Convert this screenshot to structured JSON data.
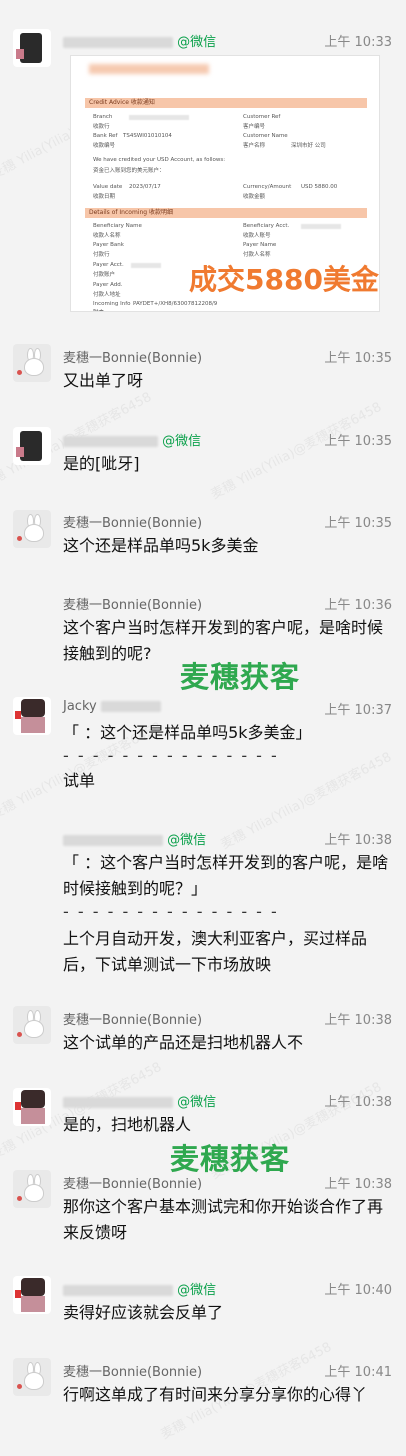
{
  "watermark": "麦穗 Yilia(Yilia)@麦穗获客6458",
  "messages": [
    {
      "sender": "@微信",
      "time": "上午 10:33"
    },
    {
      "sender": "麦穗一Bonnie(Bonnie)",
      "time": "上午 10:35",
      "text": "又出单了呀"
    },
    {
      "sender": "@微信",
      "time": "上午 10:35",
      "text": "是的[呲牙]"
    },
    {
      "sender": "麦穗一Bonnie(Bonnie)",
      "time": "上午 10:35",
      "text": "这个还是样品单吗5k多美金"
    },
    {
      "sender": "麦穗一Bonnie(Bonnie)",
      "time": "上午 10:36",
      "text": "这个客户当时怎样开发到的客户呢，是啥时候接触到的呢?"
    },
    {
      "sender": "Jacky",
      "time": "上午 10:37",
      "quote": "「        ：这个还是样品单吗5k多美金」",
      "sep": "- - - - - - - - - - - - - - -",
      "text": "试单"
    },
    {
      "sender": "@微信",
      "time": "上午 10:38",
      "quote": "「      ：这个客户当时怎样开发到的客户呢，是啥时候接触到的呢？」",
      "sep": "- - - - - - - - - - - - - - -",
      "text": "上个月自动开发，澳大利亚客户，买过样品后，下试单测试一下市场放映"
    },
    {
      "sender": "麦穗一Bonnie(Bonnie)",
      "time": "上午 10:38",
      "text": "这个试单的产品还是扫地机器人不"
    },
    {
      "sender": "@微信",
      "time": "上午 10:38",
      "text": "是的，扫地机器人"
    },
    {
      "sender": "麦穗一Bonnie(Bonnie)",
      "time": "上午 10:38",
      "text": "那你这个客户基本测试完和你开始谈合作了再来反馈呀"
    },
    {
      "sender": "@微信",
      "time": "上午 10:40",
      "text": "卖得好应该就会反单了"
    },
    {
      "sender": "麦穗一Bonnie(Bonnie)",
      "time": "上午 10:41",
      "text": "行啊这单成了有时间来分享分享你的心得丫"
    }
  ],
  "overlays": {
    "brand1": "麦穗获客",
    "brand2": "麦穗获客",
    "deal": "成交5880美金"
  },
  "doc": {
    "advice": "Credit Advice  收款通知",
    "branch": "Branch",
    "branch_cn": "收款行",
    "cust_ref": "Customer Ref",
    "cust_ref_cn": "客户编号",
    "bank_ref": "Bank Ref",
    "bank_ref_val": "TS4SWI01010104",
    "bank_ref_cn": "收款编号",
    "cust_name": "Customer Name",
    "cust_name_cn": "客户名称",
    "cust_name_val": "深圳市好          公司",
    "credited": "We have credited your USD Account, as follows:",
    "credited_cn": "资金已入账到您的美元账户：",
    "value_date": "Value date",
    "value_date_val": "2023/07/17",
    "value_date_cn": "收款日期",
    "currency": "Currency/Amount",
    "currency_val": "USD 5880.00",
    "currency_cn": "收款金额",
    "incoming": "Details of Incoming  收款明细",
    "ben_name": "Beneficiary Name",
    "ben_name_cn": "收款人名称",
    "ben_acct": "Beneficiary Acct.",
    "ben_acct_cn": "收款人账号",
    "payer_bank": "Payer Bank",
    "payer_bank_cn": "付款行",
    "payer_name": "Payer Name",
    "payer_name_cn": "付款人名称",
    "payer_acct": "Payer Acct.",
    "payer_acct_cn": "付款账户",
    "payer_add": "Payer Add.",
    "payer_add_cn": "付款人地址",
    "incoming_info": "Incoming Info",
    "incoming_info_val": "PAYDET+/XH8/63007812208/9",
    "incoming_info_cn": "附言"
  }
}
